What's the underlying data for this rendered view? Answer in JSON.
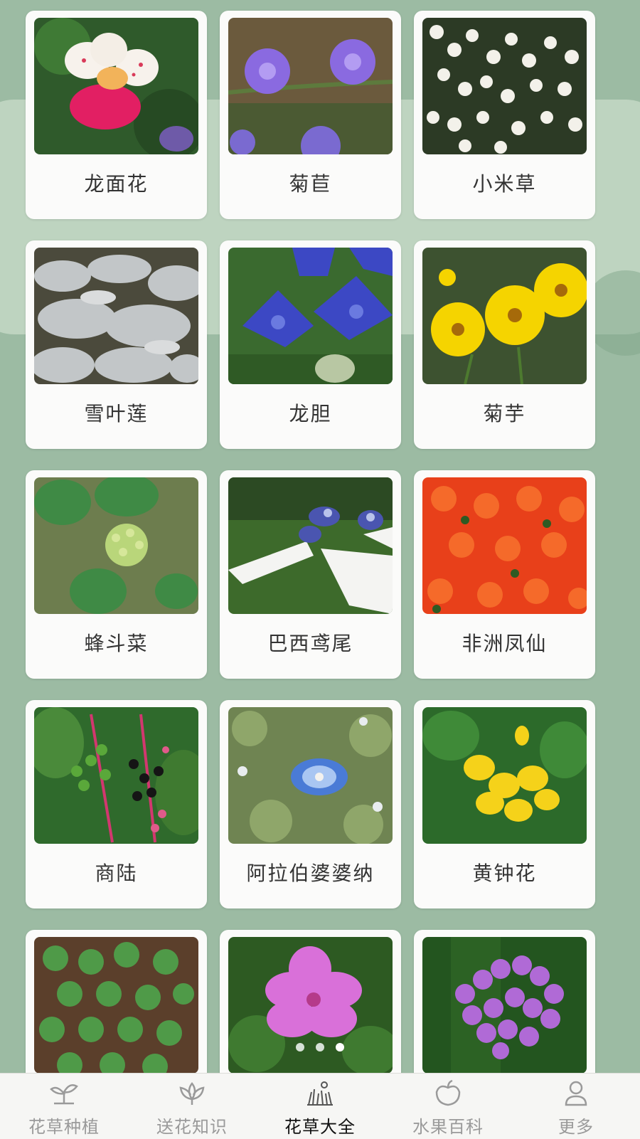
{
  "plants": [
    {
      "name": "龙面花",
      "photo": "spotted-white-pink-flower"
    },
    {
      "name": "菊苣",
      "photo": "purple-chicory-flowers"
    },
    {
      "name": "小米草",
      "photo": "small-white-flowers"
    },
    {
      "name": "雪叶莲",
      "photo": "silver-dusty-miller-leaves"
    },
    {
      "name": "龙胆",
      "photo": "blue-gentian-flowers"
    },
    {
      "name": "菊芋",
      "photo": "yellow-sunflower-like-flowers"
    },
    {
      "name": "蜂斗菜",
      "photo": "green-butterbur-plant"
    },
    {
      "name": "巴西鸢尾",
      "photo": "white-blue-iris-flower"
    },
    {
      "name": "非洲凤仙",
      "photo": "orange-impatiens-flowers"
    },
    {
      "name": "商陆",
      "photo": "pokeweed-berries"
    },
    {
      "name": "阿拉伯婆婆纳",
      "photo": "blue-speedwell-flower"
    },
    {
      "name": "黄钟花",
      "photo": "yellow-bell-flowers"
    },
    {
      "name": "",
      "photo": "green-seedlings"
    },
    {
      "name": "",
      "photo": "pink-geranium-flower"
    },
    {
      "name": "",
      "photo": "purple-verbena-flowers"
    }
  ],
  "pager": {
    "count": 3,
    "active": 2
  },
  "tabs": [
    {
      "label": "花草种植",
      "icon": "sprout-icon",
      "active": false
    },
    {
      "label": "送花知识",
      "icon": "lotus-icon",
      "active": false
    },
    {
      "label": "花草大全",
      "icon": "grass-flower-icon",
      "active": true
    },
    {
      "label": "水果百科",
      "icon": "apple-icon",
      "active": false
    },
    {
      "label": "更多",
      "icon": "user-icon",
      "active": false
    }
  ],
  "colors": {
    "background": "#9cbba3",
    "card": "#fbfbfa",
    "active_tab": "#111111",
    "inactive_tab": "#9a9a9a"
  }
}
